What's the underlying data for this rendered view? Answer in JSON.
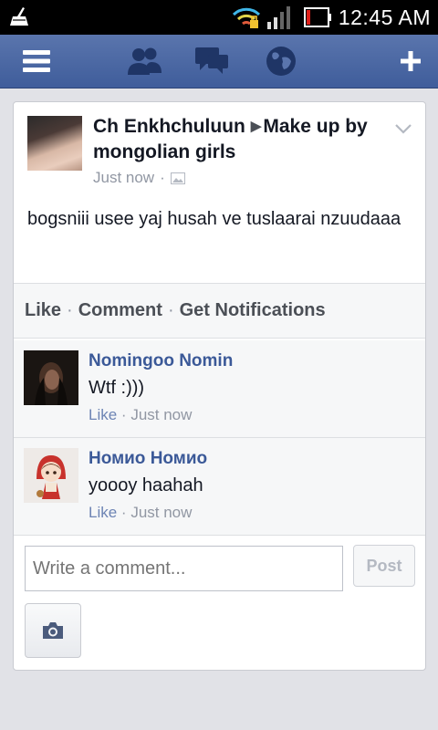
{
  "status_bar": {
    "time": "12:45 AM"
  },
  "nav": {
    "icons": [
      "menu-icon",
      "friends-icon",
      "messages-icon",
      "globe-icon",
      "plus-icon"
    ]
  },
  "post": {
    "author": "Ch Enkhchuluun",
    "group": "Make up by mongolian girls",
    "time": "Just now",
    "dot": "·",
    "body": "bogsniii usee yaj husah ve tuslaarai nzuudaaa"
  },
  "actions": {
    "like": "Like",
    "comment": "Comment",
    "notifications": "Get Notifications",
    "separator": "·"
  },
  "comments": [
    {
      "name": "Nomingoo Nomin",
      "text": "Wtf :)))",
      "like": "Like",
      "time": "Just now"
    },
    {
      "name": "Номио Номио",
      "text": "yoooy haahah",
      "like": "Like",
      "time": "Just now"
    }
  ],
  "composer": {
    "placeholder": "Write a comment...",
    "post_label": "Post"
  },
  "colors": {
    "nav_blue": "#3f5d9b",
    "link_blue": "#3b5998",
    "meta_gray": "#9197a3"
  }
}
